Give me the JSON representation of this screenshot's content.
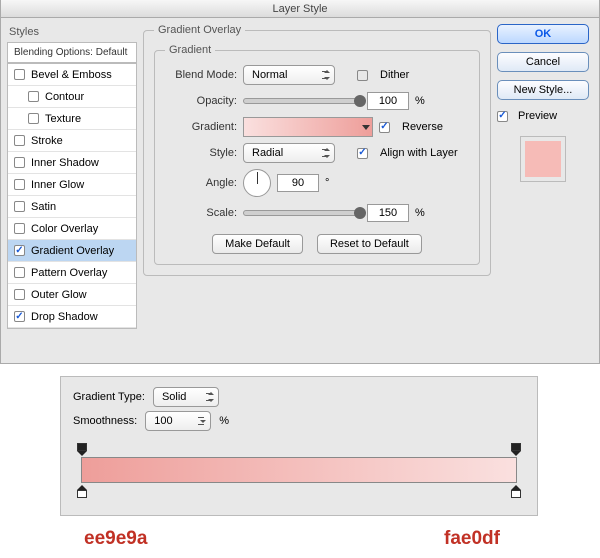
{
  "window": {
    "title": "Layer Style"
  },
  "left": {
    "styles_label": "Styles",
    "blending_options_label": "Blending Options: Default",
    "items": [
      {
        "label": "Bevel & Emboss",
        "checked": false
      },
      {
        "label": "Contour",
        "checked": false
      },
      {
        "label": "Texture",
        "checked": false
      },
      {
        "label": "Stroke",
        "checked": false
      },
      {
        "label": "Inner Shadow",
        "checked": false
      },
      {
        "label": "Inner Glow",
        "checked": false
      },
      {
        "label": "Satin",
        "checked": false
      },
      {
        "label": "Color Overlay",
        "checked": false
      },
      {
        "label": "Gradient Overlay",
        "checked": true
      },
      {
        "label": "Pattern Overlay",
        "checked": false
      },
      {
        "label": "Outer Glow",
        "checked": false
      },
      {
        "label": "Drop Shadow",
        "checked": true
      }
    ]
  },
  "center": {
    "group_title": "Gradient Overlay",
    "subgroup_title": "Gradient",
    "blend_mode_label": "Blend Mode:",
    "blend_mode_value": "Normal",
    "dither_label": "Dither",
    "opacity_label": "Opacity:",
    "opacity_value": "100",
    "opacity_unit": "%",
    "gradient_label": "Gradient:",
    "reverse_label": "Reverse",
    "style_label": "Style:",
    "style_value": "Radial",
    "align_label": "Align with Layer",
    "angle_label": "Angle:",
    "angle_value": "90",
    "angle_unit": "°",
    "scale_label": "Scale:",
    "scale_value": "150",
    "scale_unit": "%",
    "make_default": "Make Default",
    "reset_default": "Reset to Default"
  },
  "right": {
    "ok": "OK",
    "cancel": "Cancel",
    "new_style": "New Style...",
    "preview_label": "Preview"
  },
  "panel2": {
    "gradient_type_label": "Gradient Type:",
    "gradient_type_value": "Solid",
    "smoothness_label": "Smoothness:",
    "smoothness_value": "100",
    "smoothness_unit": "%"
  },
  "hex": {
    "left": "ee9e9a",
    "right": "fae0df"
  }
}
